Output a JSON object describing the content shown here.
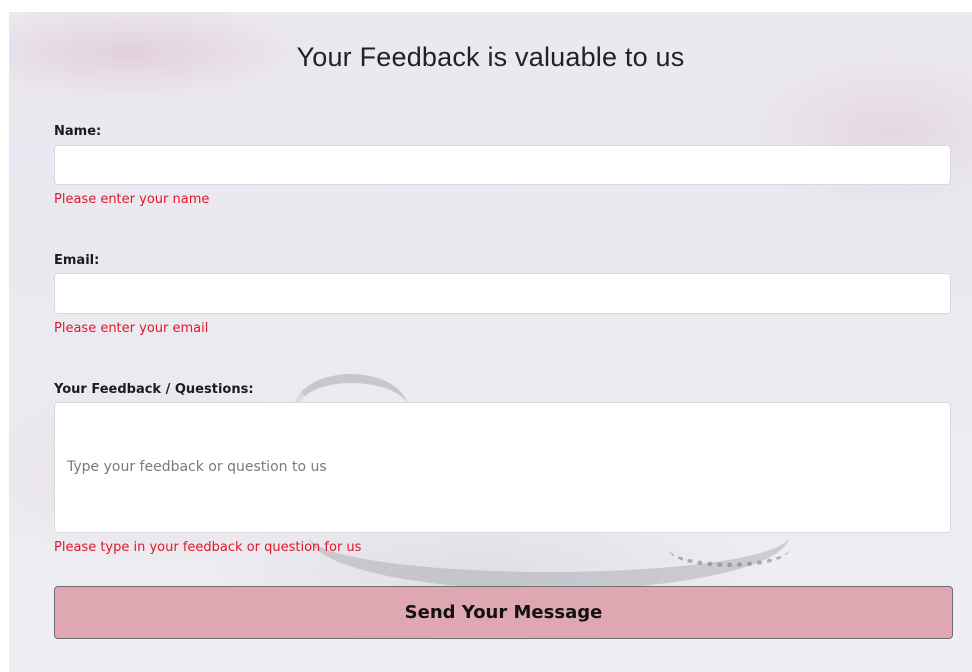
{
  "form": {
    "title": "Your Feedback is valuable to us",
    "name_label": "Name:",
    "name_value": "",
    "name_error": "Please enter your name",
    "email_label": "Email:",
    "email_value": "",
    "email_error": "Please enter your email",
    "feedback_label": "Your Feedback / Questions:",
    "feedback_placeholder": "Type your feedback or question to us",
    "feedback_error": "Please type in your feedback or question for us",
    "submit_label": "Send Your Message"
  },
  "colors": {
    "error": "#e0182a",
    "button_bg": "#dfa7b1",
    "button_border": "#6e6e74"
  }
}
